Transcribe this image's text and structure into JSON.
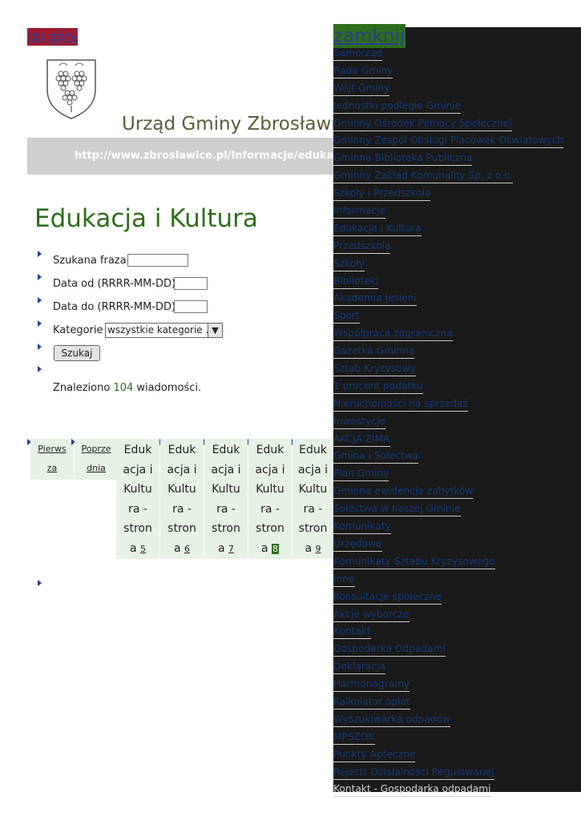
{
  "top_link": "do góry",
  "site": {
    "title": "Urząd Gminy Zbrosławice",
    "url": "http://www.zbroslawice.pl/Informacje/edukacja"
  },
  "page": {
    "title": "Edukacja i Kultura"
  },
  "search": {
    "phrase_label": "Szukana fraza",
    "date_from_label": "Data od (RRRR-MM-DD)",
    "date_to_label": "Data do (RRRR-MM-DD)",
    "category_label": "Kategorie",
    "category_selected": "wszystkie kategorie ...",
    "submit_label": "Szukaj"
  },
  "results": {
    "prefix": "Znaleziono",
    "count": "104",
    "suffix": "wiadomości."
  },
  "pagination": {
    "first": [
      "Pierws",
      "za"
    ],
    "prev": [
      "Poprze",
      "dnia"
    ],
    "pages": [
      {
        "lines": [
          "Eduk",
          "acja i",
          "Kultu",
          "ra -",
          "stron"
        ],
        "prefix": "a",
        "num": "5",
        "current": false
      },
      {
        "lines": [
          "Eduk",
          "acja i",
          "Kultu",
          "ra -",
          "stron"
        ],
        "prefix": "a",
        "num": "6",
        "current": false
      },
      {
        "lines": [
          "Eduk",
          "acja i",
          "Kultu",
          "ra -",
          "stron"
        ],
        "prefix": "a",
        "num": "7",
        "current": false
      },
      {
        "lines": [
          "Eduk",
          "acja i",
          "Kultu",
          "ra -",
          "stron"
        ],
        "prefix": "a",
        "num": "8",
        "current": true
      },
      {
        "lines": [
          "Eduk",
          "acja i",
          "Kultu",
          "ra -",
          "stron"
        ],
        "prefix": "a",
        "num": "9",
        "current": false
      }
    ]
  },
  "menu": {
    "close_label": "zamknij",
    "items": [
      "Samorząd",
      "Rada Gminy",
      "Wójt Gminy",
      "Jednostki podległe Gminie",
      "Gminny Ośrodek Pomocy Społecznej",
      "Gminny Zespół Obsługi Placówek Oświatowych",
      "Gminna Biblioteka Publiczna",
      "Gminny Zakład Komunalny Sp. z o.o.",
      "Szkoły i Przedszkola",
      "Informacje",
      "Edukacja i Kultura",
      "Przedszkola",
      "Szkoły",
      "Biblioteki",
      "Akademia Jesieni",
      "Sport",
      "Współpraca zagraniczna",
      "Gazetka Gminna",
      "Sztab Kryzysowy",
      "1 procent podatku",
      "Nieruchomości na sprzedaż",
      "Inwestycje",
      "AKCJA ZIMA",
      "Gmina i Sołectwa",
      "Plan Gminy",
      "Gminna ewidencja zabytków",
      "Sołectwa w naszej Gminie",
      "Komunikaty",
      "Urzędowe",
      "Komunikaty Sztabu Kryzysowego",
      "Inne",
      "Konsultacje społeczne",
      "Akcje wyborcze",
      "Kontakt",
      "Gospodarka Odpadami",
      "Deklaracja",
      "Harmonogramy",
      "Kalkulator opłat",
      "Wyszukiwarka odpadów",
      "MPSZOK",
      "Punkty Apteczne",
      "Rejestr Działalności Regulowanej",
      "Kontakt - Gospodarka odpadami"
    ]
  },
  "colors": {
    "accent_green": "#2e6e1a",
    "link_blue": "#143a78",
    "top_link_bg": "#9e1b2f",
    "overlay_bg": "#1a1a1a"
  },
  "icons": {
    "crest": "coat-of-arms-grapes-icon",
    "bullet": "triangle-bullet-icon"
  }
}
